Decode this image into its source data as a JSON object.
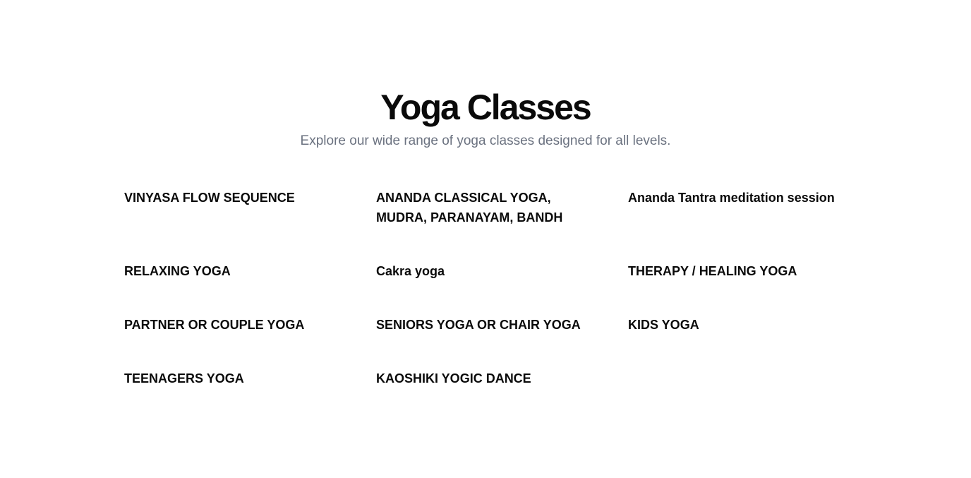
{
  "header": {
    "title": "Yoga Classes",
    "subtitle": "Explore our wide range of yoga classes designed for all levels."
  },
  "classes": [
    {
      "label": "VINYASA FLOW SEQUENCE"
    },
    {
      "label": "ANANDA CLASSICAL YOGA, MUDRA, PARANAYAM, BANDH"
    },
    {
      "label": "Ananda Tantra meditation session"
    },
    {
      "label": "RELAXING YOGA"
    },
    {
      "label": "Cakra yoga"
    },
    {
      "label": "THERAPY / HEALING YOGA"
    },
    {
      "label": "PARTNER OR COUPLE YOGA"
    },
    {
      "label": "SENIORS YOGA OR CHAIR YOGA"
    },
    {
      "label": "KIDS YOGA"
    },
    {
      "label": "TEENAGERS YOGA"
    },
    {
      "label": "KAOSHIKI YOGIC DANCE"
    }
  ]
}
